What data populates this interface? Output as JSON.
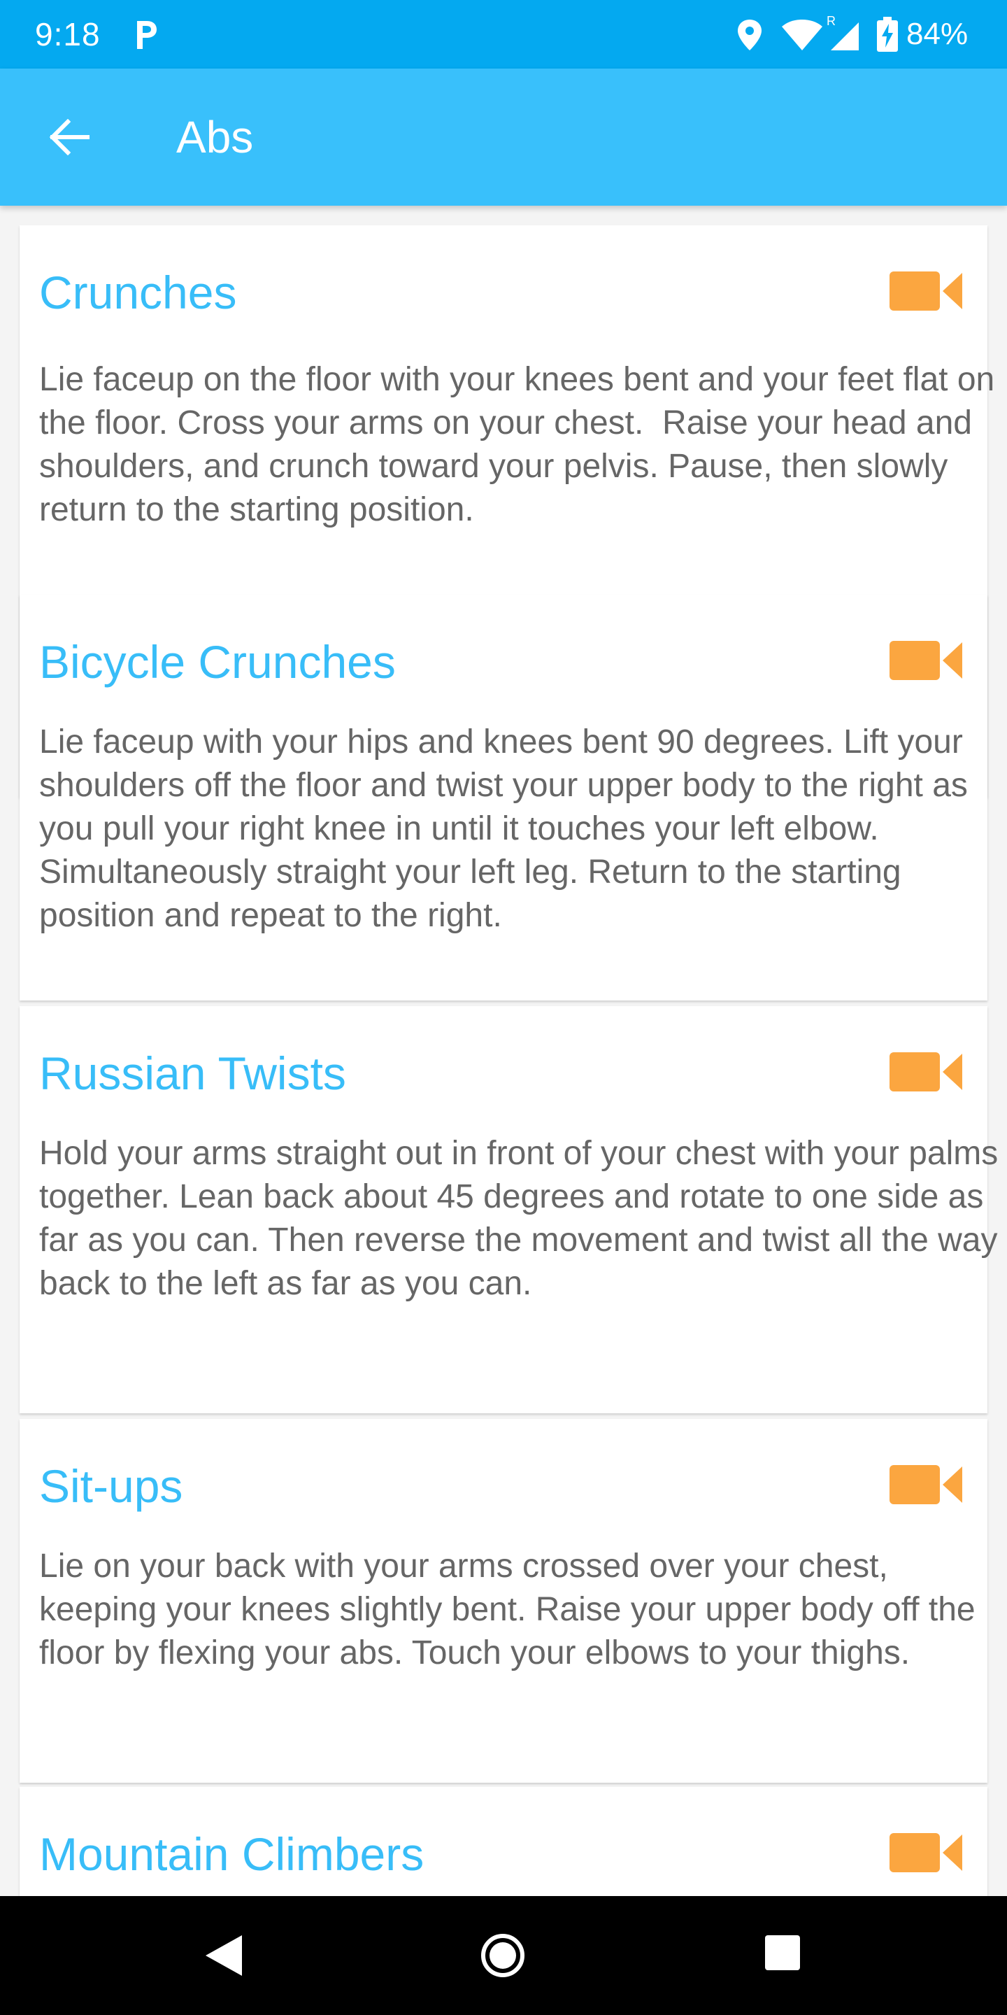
{
  "status_bar": {
    "time": "9:18",
    "battery": "84%",
    "icons": [
      "p-icon",
      "location-icon",
      "wifi-icon",
      "cell-signal-icon",
      "battery-charging-icon"
    ]
  },
  "app_bar": {
    "title": "Abs",
    "back_icon": "arrow-back-icon"
  },
  "exercises": [
    {
      "title": "Crunches",
      "description": "Lie faceup on the floor with your knees bent and your feet flat on the floor. Cross your arms on your chest.  Raise your head and shoulders, and crunch toward your pelvis. Pause, then slowly return to the starting position."
    },
    {
      "title": "Bicycle Crunches",
      "description": "Lie faceup with your hips and knees bent 90 degrees. Lift your shoulders off the floor and twist your upper body to the right as you pull your right knee in until it touches your left elbow. Simultaneously straight your left leg. Return to the starting position and repeat to the right."
    },
    {
      "title": "Russian Twists",
      "description": "Hold your arms straight out in front of your chest with your palms together. Lean back about 45 degrees and rotate to one side as far as you can. Then reverse the movement and twist all the way back to the left as far as you can."
    },
    {
      "title": "Sit-ups",
      "description": "Lie on your back with your arms crossed over your chest, keeping your knees slightly bent. Raise your upper body off the floor by flexing your abs. Touch your elbows to your thighs."
    },
    {
      "title": "Mountain Climbers",
      "description": ""
    }
  ],
  "colors": {
    "status_bar": "#04a9f0",
    "app_bar": "#39c0fb",
    "title_text": "#38bdf8",
    "video_icon": "#fba640",
    "body_text": "#666666"
  },
  "nav_bar": {
    "icons": [
      "nav-back-icon",
      "nav-home-icon",
      "nav-recents-icon"
    ]
  }
}
